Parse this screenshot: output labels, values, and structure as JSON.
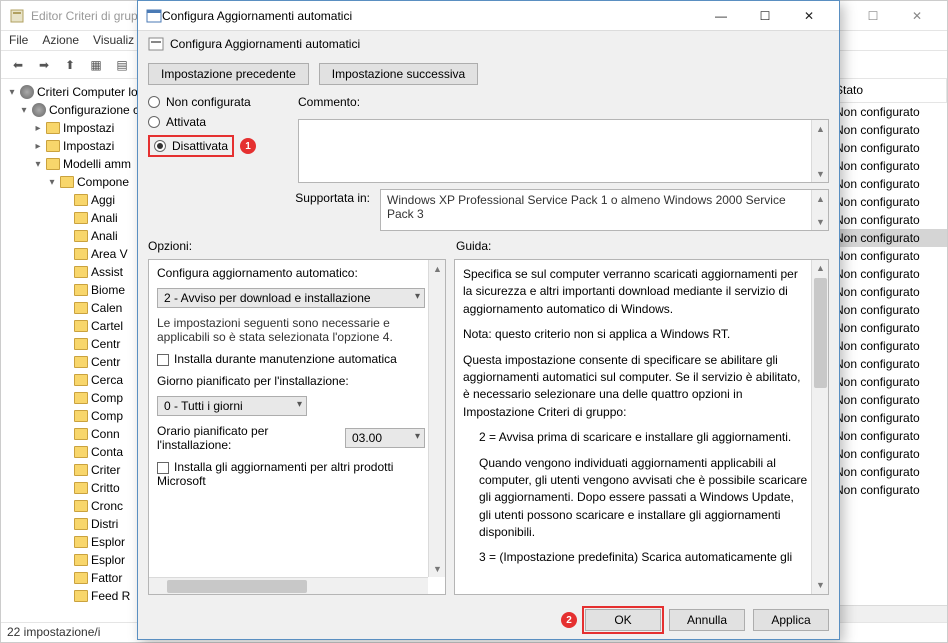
{
  "main": {
    "title": "Editor Criteri di grup",
    "menus": [
      "File",
      "Azione",
      "Visualiz"
    ],
    "status": "22 impostazione/i",
    "tree": {
      "root": "Criteri Computer loc",
      "cfg": "Configurazione c",
      "items_l2": [
        "Impostazi",
        "Impostazi",
        "Modelli amm"
      ],
      "comp": "Compone",
      "leaves": [
        "Aggi",
        "Anali",
        "Anali",
        "Area V",
        "Assist",
        "Biome",
        "Calen",
        "Cartel",
        "Centr",
        "Centr",
        "Cerca",
        "Comp",
        "Comp",
        "Conn",
        "Conta",
        "Criter",
        "Critto",
        "Cronc",
        "Distri",
        "Esplor",
        "Esplor",
        "Fattor",
        "Feed R"
      ]
    },
    "rightHeader": "Stato",
    "states": [
      "Non configurato",
      "Non configurato",
      "Non configurato",
      "Non configurato",
      "Non configurato",
      "Non configurato",
      "Non configurato",
      "Non configurato",
      "Non configurato",
      "Non configurato",
      "Non configurato",
      "Non configurato",
      "Non configurato",
      "Non configurato",
      "Non configurato",
      "Non configurato",
      "Non configurato",
      "Non configurato",
      "Non configurato",
      "Non configurato",
      "Non configurato",
      "Non configurato"
    ],
    "selectedStateIndex": 7
  },
  "dlg": {
    "title": "Configura Aggiornamenti automatici",
    "subtitle": "Configura Aggiornamenti automatici",
    "prevBtn": "Impostazione precedente",
    "nextBtn": "Impostazione successiva",
    "radios": {
      "notConfigured": "Non configurata",
      "enabled": "Attivata",
      "disabled": "Disattivata",
      "selected": "disabled"
    },
    "commentLabel": "Commento:",
    "supportedLabel": "Supportata in:",
    "supportedText": "Windows XP Professional Service Pack 1 o almeno Windows 2000 Service Pack 3",
    "optionsLabel": "Opzioni:",
    "guideLabel": "Guida:",
    "options": {
      "configLabel": "Configura aggiornamento automatico:",
      "configValue": "2 - Avviso per download e installazione",
      "note": "Le impostazioni seguenti sono necessarie e applicabili so è stata selezionata l'opzione 4.",
      "chk1": "Installa durante manutenzione automatica",
      "dayLabel": "Giorno pianificato per l'installazione:",
      "dayValue": "0 - Tutti i giorni",
      "timeLabel": "Orario pianificato per l'installazione:",
      "timeValue": "03.00",
      "chk2": "Installa gli aggiornamenti per altri prodotti Microsoft"
    },
    "guide": {
      "p1": "Specifica se sul computer verranno scaricati aggiornamenti per la sicurezza e altri importanti download mediante il servizio di aggiornamento automatico di Windows.",
      "p2": "Nota: questo criterio non si applica a Windows RT.",
      "p3": "Questa impostazione consente di specificare se abilitare gli aggiornamenti automatici sul computer. Se il servizio è abilitato, è necessario selezionare una delle quattro opzioni in Impostazione Criteri di gruppo:",
      "p4": "2 = Avvisa prima di scaricare e installare gli aggiornamenti.",
      "p5": "Quando vengono individuati aggiornamenti applicabili al computer, gli utenti vengono avvisati che è possibile scaricare gli aggiornamenti. Dopo essere passati a Windows Update, gli utenti possono scaricare e installare gli aggiornamenti disponibili.",
      "p6": "3 = (Impostazione predefinita) Scarica automaticamente gli"
    },
    "buttons": {
      "ok": "OK",
      "cancel": "Annulla",
      "apply": "Applica"
    },
    "badges": {
      "one": "1",
      "two": "2"
    }
  }
}
